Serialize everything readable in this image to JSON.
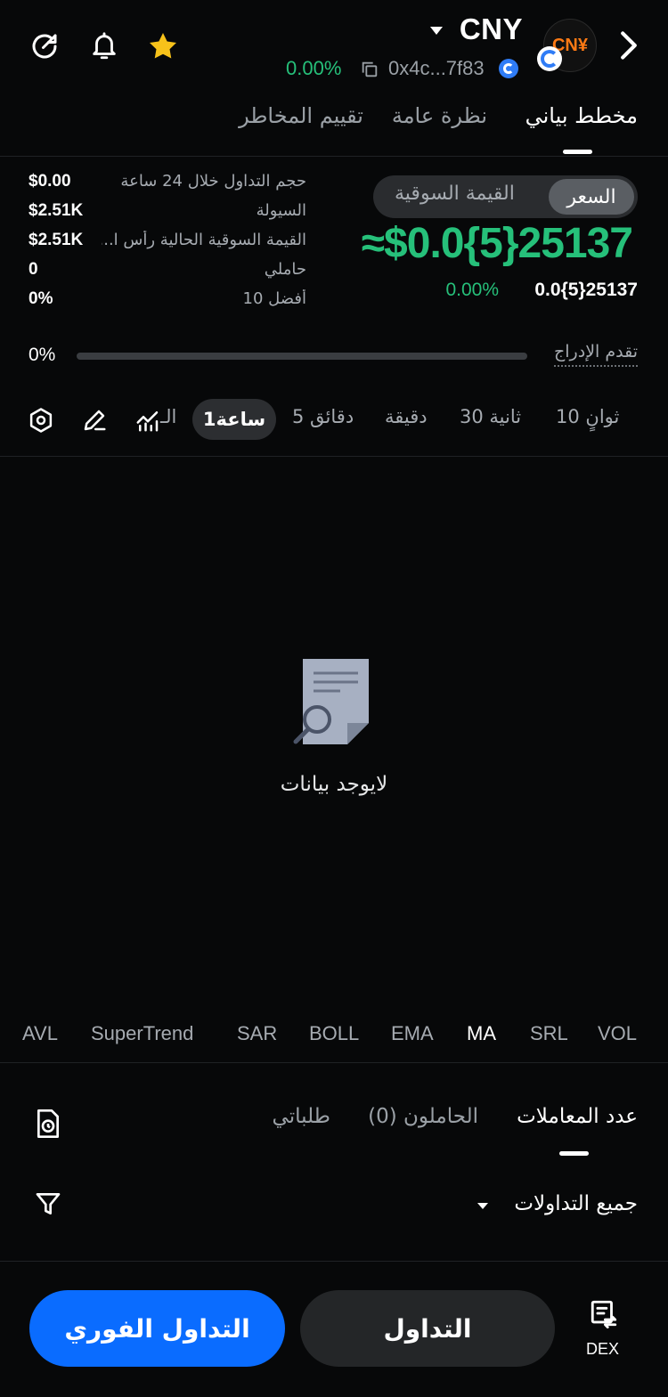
{
  "header": {
    "title": "CNY",
    "avatar_text": "CN¥",
    "change_pct": "0.00%",
    "address": "0x4c...7f83",
    "icons": [
      "share-icon",
      "bell-icon",
      "star-icon",
      "copy-icon",
      "chevron-right-icon"
    ]
  },
  "top_tabs": [
    {
      "label": "مخطط بياني",
      "active": true
    },
    {
      "label": "نظرة عامة",
      "active": false
    },
    {
      "label": "تقييم المخاطر",
      "active": false
    }
  ],
  "toggle": {
    "active": "السعر",
    "inactive": "القيمة السوقية"
  },
  "price": {
    "main": "≈$0.0{5}25137",
    "sub_value": "0.0{5}25137",
    "sub_change": "0.00%"
  },
  "stats": [
    {
      "label": "حجم التداول خلال 24 ساعة",
      "value": "$0.00"
    },
    {
      "label": "السيولة",
      "value": "$2.51K"
    },
    {
      "label": "القيمة السوقية الحالية رأس ا...",
      "value": "$2.51K"
    },
    {
      "label": "حاملي",
      "value": "0"
    },
    {
      "label": "أفضل 10",
      "value": "0%"
    }
  ],
  "progress": {
    "label": "تقدم الإدراج",
    "value_text": "0%",
    "fraction": 0
  },
  "timeframes": {
    "items": [
      "10 ثوانٍ",
      "30 ثانية",
      "دقيقة",
      "5 دقائق",
      "1ساعة",
      "الـ"
    ],
    "active": "1ساعة"
  },
  "empty_state": {
    "text": "لايوجد بيانات"
  },
  "indicators": {
    "items": [
      "AVL",
      "SuperTrend",
      "SAR",
      "BOLL",
      "EMA",
      "MA",
      "SRL",
      "VOL"
    ],
    "active": "MA"
  },
  "bottom_tabs": [
    {
      "label": "عدد المعاملات",
      "active": true
    },
    {
      "label": "الحاملون (0)",
      "active": false
    },
    {
      "label": "طلباتي",
      "active": false
    }
  ],
  "filter": {
    "label": "جميع التداولات"
  },
  "actions": {
    "trade": "التداول",
    "instant_trade": "التداول الفوري",
    "dex": "DEX"
  },
  "colors": {
    "background": "#070809",
    "positive": "#26c07a",
    "accent": "#0a6cff",
    "star": "#f7c21a"
  }
}
